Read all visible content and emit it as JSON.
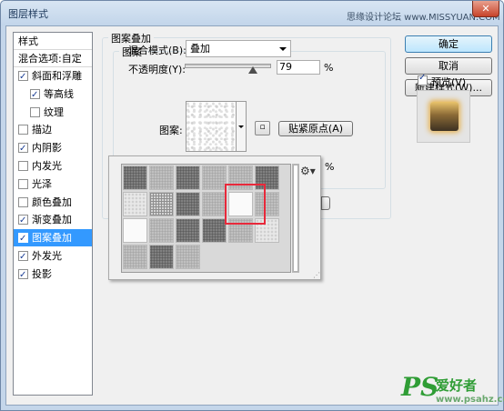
{
  "window": {
    "title": "图层样式",
    "watermark": "思缘设计论坛 www.MISSYUAN.COM"
  },
  "styles_list": {
    "header": "样式",
    "blend_options": "混合选项:自定",
    "items": [
      {
        "label": "斜面和浮雕",
        "checked": true
      },
      {
        "label": "等高线",
        "checked": true,
        "indent": true
      },
      {
        "label": "纹理",
        "checked": false,
        "indent": true
      },
      {
        "label": "描边",
        "checked": false
      },
      {
        "label": "内阴影",
        "checked": true
      },
      {
        "label": "内发光",
        "checked": false
      },
      {
        "label": "光泽",
        "checked": false
      },
      {
        "label": "颜色叠加",
        "checked": false
      },
      {
        "label": "渐变叠加",
        "checked": true
      },
      {
        "label": "图案叠加",
        "checked": true,
        "selected": true
      },
      {
        "label": "外发光",
        "checked": true
      },
      {
        "label": "投影",
        "checked": true
      }
    ]
  },
  "buttons": {
    "ok": "确定",
    "cancel": "取消",
    "new_style": "新建样式(W)...",
    "preview": "预览(V)"
  },
  "pattern_overlay": {
    "section_title": "图案叠加",
    "group_title": "图案",
    "blend_mode_label": "混合模式(B):",
    "blend_mode_value": "叠加",
    "opacity_label": "不透明度(Y):",
    "opacity_value": "79",
    "opacity_unit": "%",
    "opacity_percent": 79,
    "pattern_label": "图案:",
    "snap_origin": "贴紧原点(A)",
    "behind_percent_unit": "%"
  },
  "branding": {
    "logo": "PS",
    "logo_cn": "爱好者",
    "url": "www.psahz.com"
  },
  "colors": {
    "selected_row": "#3399ff",
    "highlight": "#e8283a",
    "logo": "#2f9d35"
  }
}
